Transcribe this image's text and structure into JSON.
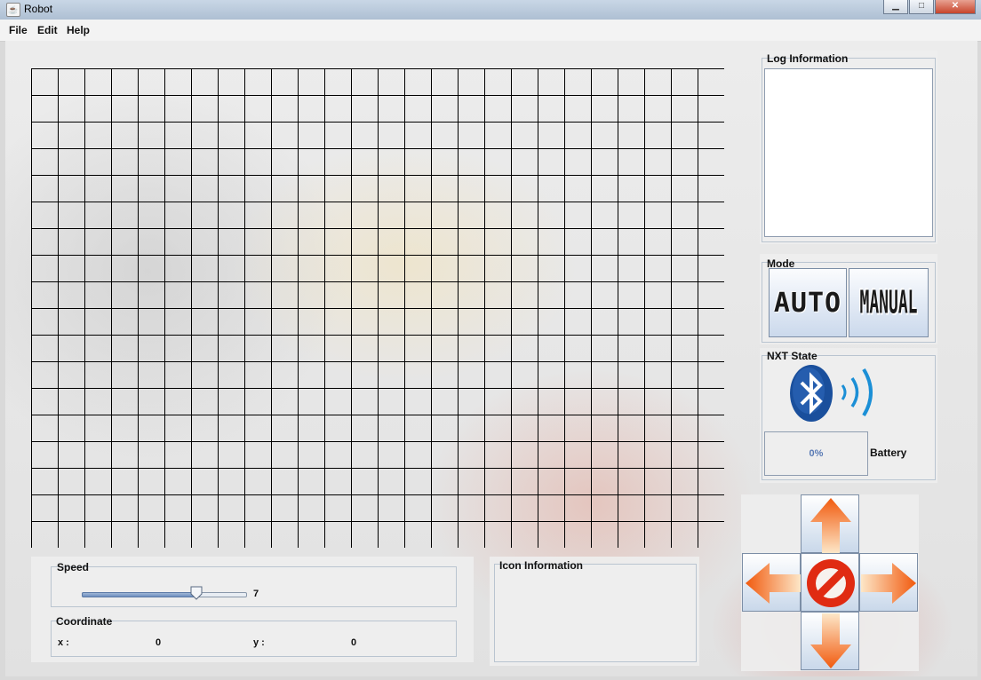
{
  "window": {
    "title": "Robot",
    "app_icon": "java-icon",
    "buttons": [
      "minimize-icon",
      "maximize-icon",
      "close-icon"
    ]
  },
  "menu": {
    "items": [
      "File",
      "Edit",
      "Help"
    ]
  },
  "grid": {
    "rows": 18,
    "cols": 26,
    "line_color": "#000000"
  },
  "log_panel": {
    "title": "Log Information",
    "content": ""
  },
  "mode_panel": {
    "title": "Mode",
    "auto_label": "AUTO",
    "manual_label": "MANUAL"
  },
  "nxt_panel": {
    "title": "NXT State",
    "bluetooth_icon": "bluetooth-icon",
    "battery_percent": "0%",
    "battery_label": "Battery"
  },
  "speed_panel": {
    "title": "Speed",
    "value": "7",
    "min": 0,
    "max": 10
  },
  "coordinate_panel": {
    "title": "Coordinate",
    "x_label": "x :",
    "x_value": "0",
    "y_label": "y :",
    "y_value": "0"
  },
  "icon_panel": {
    "title": "Icon Information"
  },
  "controls": {
    "up": "arrow-up-icon",
    "down": "arrow-down-icon",
    "left": "arrow-left-icon",
    "right": "arrow-right-icon",
    "stop": "stop-icon",
    "arrow_color": "#f26a12",
    "stop_color": "#e02b12"
  }
}
